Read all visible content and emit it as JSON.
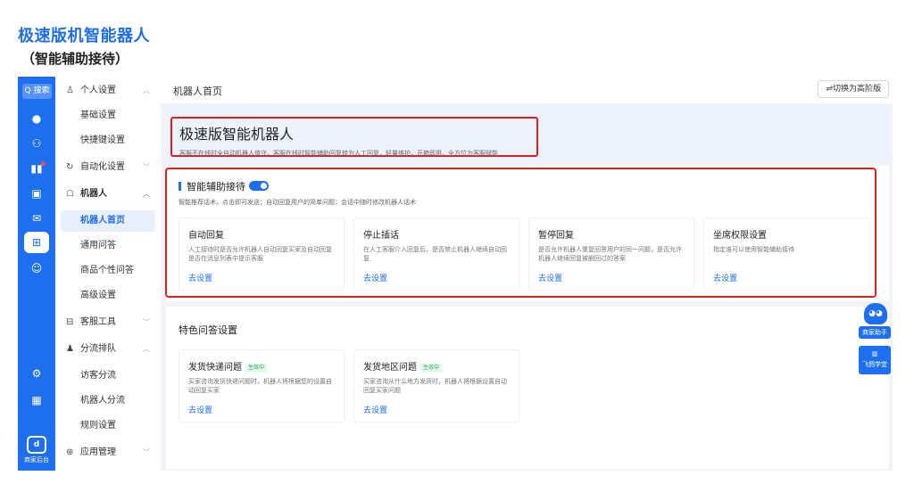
{
  "doc": {
    "title": "极速版机智能器人",
    "subtitle": "（智能辅助接待）"
  },
  "rail": {
    "search": "Q 搜索",
    "bottom_label": "商家后台"
  },
  "menu": {
    "personal": "个人设置",
    "basic": "基础设置",
    "shortcut": "快捷键设置",
    "automation": "自动化设置",
    "robot": "机器人",
    "robot_home": "机器人首页",
    "general_qa": "通用问答",
    "product_qa": "商品个性问答",
    "advanced": "高级设置",
    "cs_tools": "客服工具",
    "routing": "分流排队",
    "visitor_routing": "访客分流",
    "robot_routing": "机器人分流",
    "rule_settings": "规则设置",
    "app_mgmt": "应用管理"
  },
  "header": {
    "title": "机器人首页",
    "switch": "⇌切换为高阶版"
  },
  "banner": {
    "title": "极速版智能机器人",
    "desc": "客服不在线时全自动机器人值守，客服在线时智能辅助回复转为人工回复，轻量维护，开箱即用，全方位为客服赋能"
  },
  "smart": {
    "title": "智能辅助接待",
    "desc": "智能推荐话术，点击即可发送；自动回复用户的简单问题；会话中随时修改机器人话术",
    "features": [
      {
        "title": "自动回复",
        "desc": "人工接待时是否允许机器人自动回复买家及自动回复是否在消息列表中提示客服",
        "link": "去设置"
      },
      {
        "title": "停止插话",
        "desc": "在人工客服介入回复后，是否禁止机器人继续自动回复",
        "link": "去设置"
      },
      {
        "title": "暂停回复",
        "desc": "是否允许机器人重复回答用户的同一问题，是否允许机器人继续回复被删回过的答案",
        "link": "去设置"
      },
      {
        "title": "坐席权限设置",
        "desc": "指定谁可以使用智能辅助接待",
        "link": "去设置"
      }
    ]
  },
  "special": {
    "title": "特色问答设置",
    "features": [
      {
        "title": "发货快递问题",
        "badge": "生效中",
        "desc": "买家咨询发货快递问题时，机器人将根据您的设置自动回复买家",
        "link": "去设置"
      },
      {
        "title": "发货地区问题",
        "badge": "生效中",
        "desc": "买家咨询从什么地方发货时，机器人将根据设置自动回复买家问题",
        "link": "去设置"
      }
    ]
  },
  "float": {
    "assistant": "商家助手",
    "learn": "飞鸽学堂"
  },
  "colors": {
    "brand": "#1e6ff0",
    "highlight_frame": "#e02020",
    "active_badge": "#2dab5e"
  }
}
